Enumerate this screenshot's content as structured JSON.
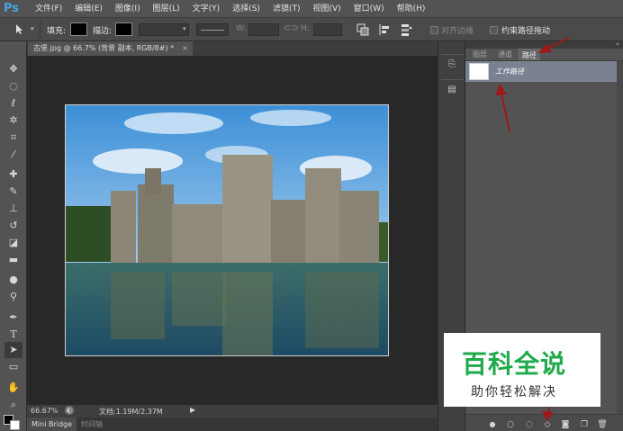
{
  "app": {
    "logo": "Ps"
  },
  "menu": [
    "文件(F)",
    "编辑(E)",
    "图像(I)",
    "图层(L)",
    "文字(Y)",
    "选择(S)",
    "滤镜(T)",
    "视图(V)",
    "窗口(W)",
    "帮助(H)"
  ],
  "options": {
    "fill_label": "填充:",
    "stroke_label": "描边:",
    "w_label": "W:",
    "h_label": "H:",
    "align_edges": "对齐边缘",
    "constrain_path": "约束路径拖动"
  },
  "document": {
    "tab_title": "古堡.jpg @ 66.7% (背景 副本, RGB/8#) *",
    "close_glyph": "×",
    "zoom": "66.67%",
    "doc_info": "文档:1.19M/2.37M"
  },
  "bottom_tabs": [
    "Mini Bridge",
    "时间轴"
  ],
  "panel": {
    "tabs": [
      "图层",
      "通道",
      "路径"
    ],
    "active_tab": "路径",
    "path_item": "工作路径"
  },
  "watermark": {
    "title": "百科全说",
    "subtitle": "助你轻松解决"
  },
  "colors": {
    "accent_red": "#a01818",
    "watermark_green": "#1faa4b",
    "path_row_bg": "#7a8291"
  },
  "icons": [
    "move-tool-icon",
    "marquee-tool-icon",
    "lasso-tool-icon",
    "quick-select-tool-icon",
    "crop-tool-icon",
    "eyedropper-tool-icon",
    "healing-brush-icon",
    "brush-tool-icon",
    "clone-stamp-icon",
    "history-brush-icon",
    "eraser-tool-icon",
    "gradient-tool-icon",
    "blur-tool-icon",
    "dodge-tool-icon",
    "pen-tool-icon",
    "type-tool-icon",
    "path-select-tool-icon",
    "rectangle-tool-icon",
    "hand-tool-icon",
    "zoom-tool-icon"
  ]
}
